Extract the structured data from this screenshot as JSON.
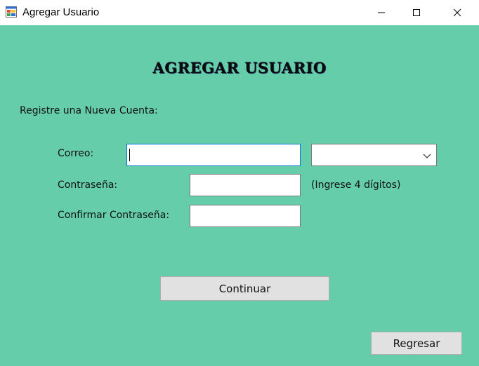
{
  "window": {
    "title": "Agregar Usuario",
    "icon": "form-app-icon",
    "controls": [
      "minimize-icon",
      "maximize-icon",
      "close-icon"
    ]
  },
  "form": {
    "heading": "AGREGAR USUARIO",
    "register_label": "Registre una Nueva Cuenta:",
    "email_label": "Correo:",
    "email_value": "",
    "domain_selected": "",
    "password_label": "Contraseña:",
    "password_value": "",
    "password_hint": "(Ingrese 4 dígitos)",
    "confirm_label": "Confirmar Contraseña:",
    "confirm_value": ""
  },
  "buttons": {
    "continue_label": "Continuar",
    "back_label": "Regresar"
  },
  "colors": {
    "background": "#66cdaa",
    "button": "#e1e1e1",
    "focus_border": "#0078d7"
  }
}
